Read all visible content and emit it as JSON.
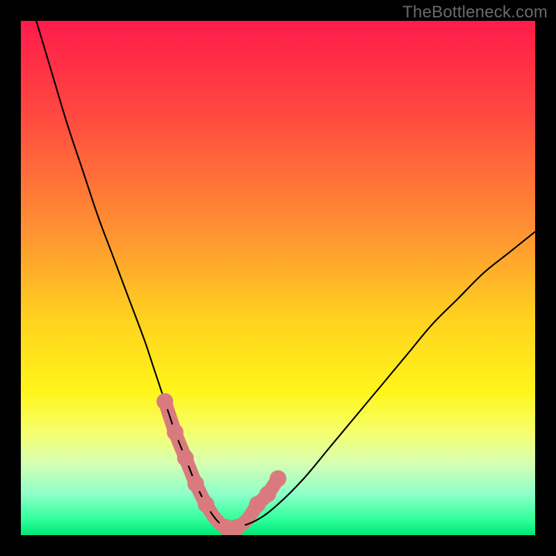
{
  "watermark": "TheBottleneck.com",
  "chart_data": {
    "type": "line",
    "title": "",
    "xlabel": "",
    "ylabel": "",
    "xlim": [
      0,
      100
    ],
    "ylim": [
      0,
      100
    ],
    "grid": false,
    "legend": false,
    "background_gradient": [
      {
        "pos": 0.0,
        "color": "#ff1b4b"
      },
      {
        "pos": 0.18,
        "color": "#ff4840"
      },
      {
        "pos": 0.4,
        "color": "#ff8f33"
      },
      {
        "pos": 0.58,
        "color": "#ffd21f"
      },
      {
        "pos": 0.72,
        "color": "#fff51a"
      },
      {
        "pos": 0.8,
        "color": "#f6ff6d"
      },
      {
        "pos": 0.86,
        "color": "#d6ffb2"
      },
      {
        "pos": 0.92,
        "color": "#8dffc8"
      },
      {
        "pos": 0.97,
        "color": "#2fff9a"
      },
      {
        "pos": 1.0,
        "color": "#00e676"
      }
    ],
    "series": [
      {
        "name": "bottleneck-curve",
        "color": "#000000",
        "x": [
          3,
          6,
          9,
          12,
          15,
          18,
          21,
          24,
          26,
          28,
          30,
          32,
          34,
          36,
          38,
          40,
          42,
          46,
          50,
          55,
          60,
          65,
          70,
          75,
          80,
          85,
          90,
          95,
          100
        ],
        "y": [
          100,
          90,
          80,
          71,
          62,
          54,
          46,
          38,
          32,
          26,
          20,
          15,
          10,
          6,
          3,
          1.5,
          1.5,
          3,
          6,
          11,
          17,
          23,
          29,
          35,
          41,
          46,
          51,
          55,
          59
        ]
      }
    ],
    "highlight_segments": [
      {
        "name": "left-highlight",
        "color": "#d97b7e",
        "x": [
          28,
          30,
          32,
          34
        ],
        "y": [
          26,
          20,
          15,
          10
        ]
      },
      {
        "name": "floor-highlight",
        "color": "#d97b7e",
        "x": [
          34,
          36,
          38,
          40,
          42
        ],
        "y": [
          10,
          6,
          3,
          1.5,
          1.5
        ]
      },
      {
        "name": "right-highlight",
        "color": "#d97b7e",
        "x": [
          42,
          44,
          46
        ],
        "y": [
          1.5,
          3,
          6
        ]
      },
      {
        "name": "right-upper-highlight",
        "color": "#d97b7e",
        "x": [
          46,
          48,
          50
        ],
        "y": [
          6,
          8,
          11
        ]
      }
    ],
    "highlight_dots": [
      {
        "x": 28,
        "y": 26
      },
      {
        "x": 30,
        "y": 20
      },
      {
        "x": 32,
        "y": 15
      },
      {
        "x": 34,
        "y": 10
      },
      {
        "x": 36,
        "y": 6
      },
      {
        "x": 40,
        "y": 1.5
      },
      {
        "x": 42,
        "y": 1.5
      },
      {
        "x": 46,
        "y": 6
      },
      {
        "x": 48,
        "y": 8
      },
      {
        "x": 50,
        "y": 11
      }
    ]
  }
}
